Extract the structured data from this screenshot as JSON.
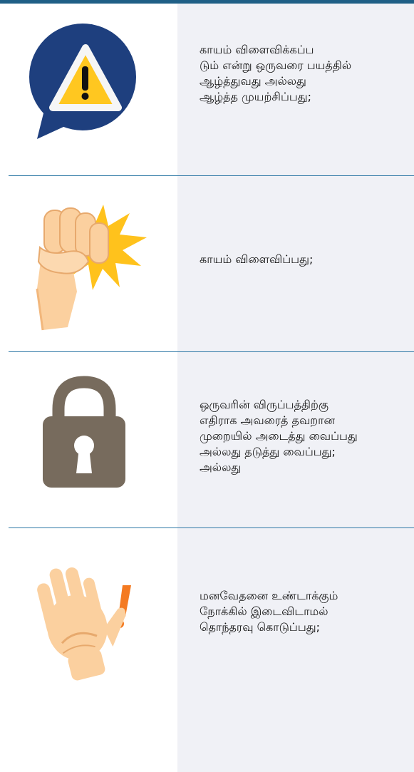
{
  "rows": [
    {
      "icon": "warning-speech-bubble-icon",
      "lines": [
        "காயம் விளைவிக்கப்ப",
        "டும் என்று ஒருவரை பயத்தில்",
        "ஆழ்த்துவது அல்லது",
        "ஆழ்த்த  முயற்சிப்பது;"
      ]
    },
    {
      "icon": "fist-punch-icon",
      "lines": [
        "காயம் விளைவிப்பது;"
      ]
    },
    {
      "icon": "padlock-icon",
      "lines": [
        "ஒருவரின் விருப்பத்திற்கு",
        "எதிராக அவரைத் தவறான",
        "முறையில் அடைத்து வைப்பது",
        "அல்லது தடுத்து வைப்பது;",
        "அல்லது"
      ]
    },
    {
      "icon": "raised-hand-exclamation-icon",
      "lines": [
        "மனவேதனை உண்டாக்கும்",
        "நோக்கில் இடைவிடாமல்",
        "தொந்தரவு கொடுப்பது;"
      ]
    }
  ],
  "colors": {
    "top_rule": "#1f5f86",
    "divider": "#2f79a6",
    "panel": "#f0f1f6",
    "bubble": "#1e3f7e",
    "warning_yellow": "#ffc720",
    "lock": "#776b5d",
    "skin": "#fbd09f",
    "burst": "#ffc21c",
    "exclamation": "#f47a21"
  }
}
